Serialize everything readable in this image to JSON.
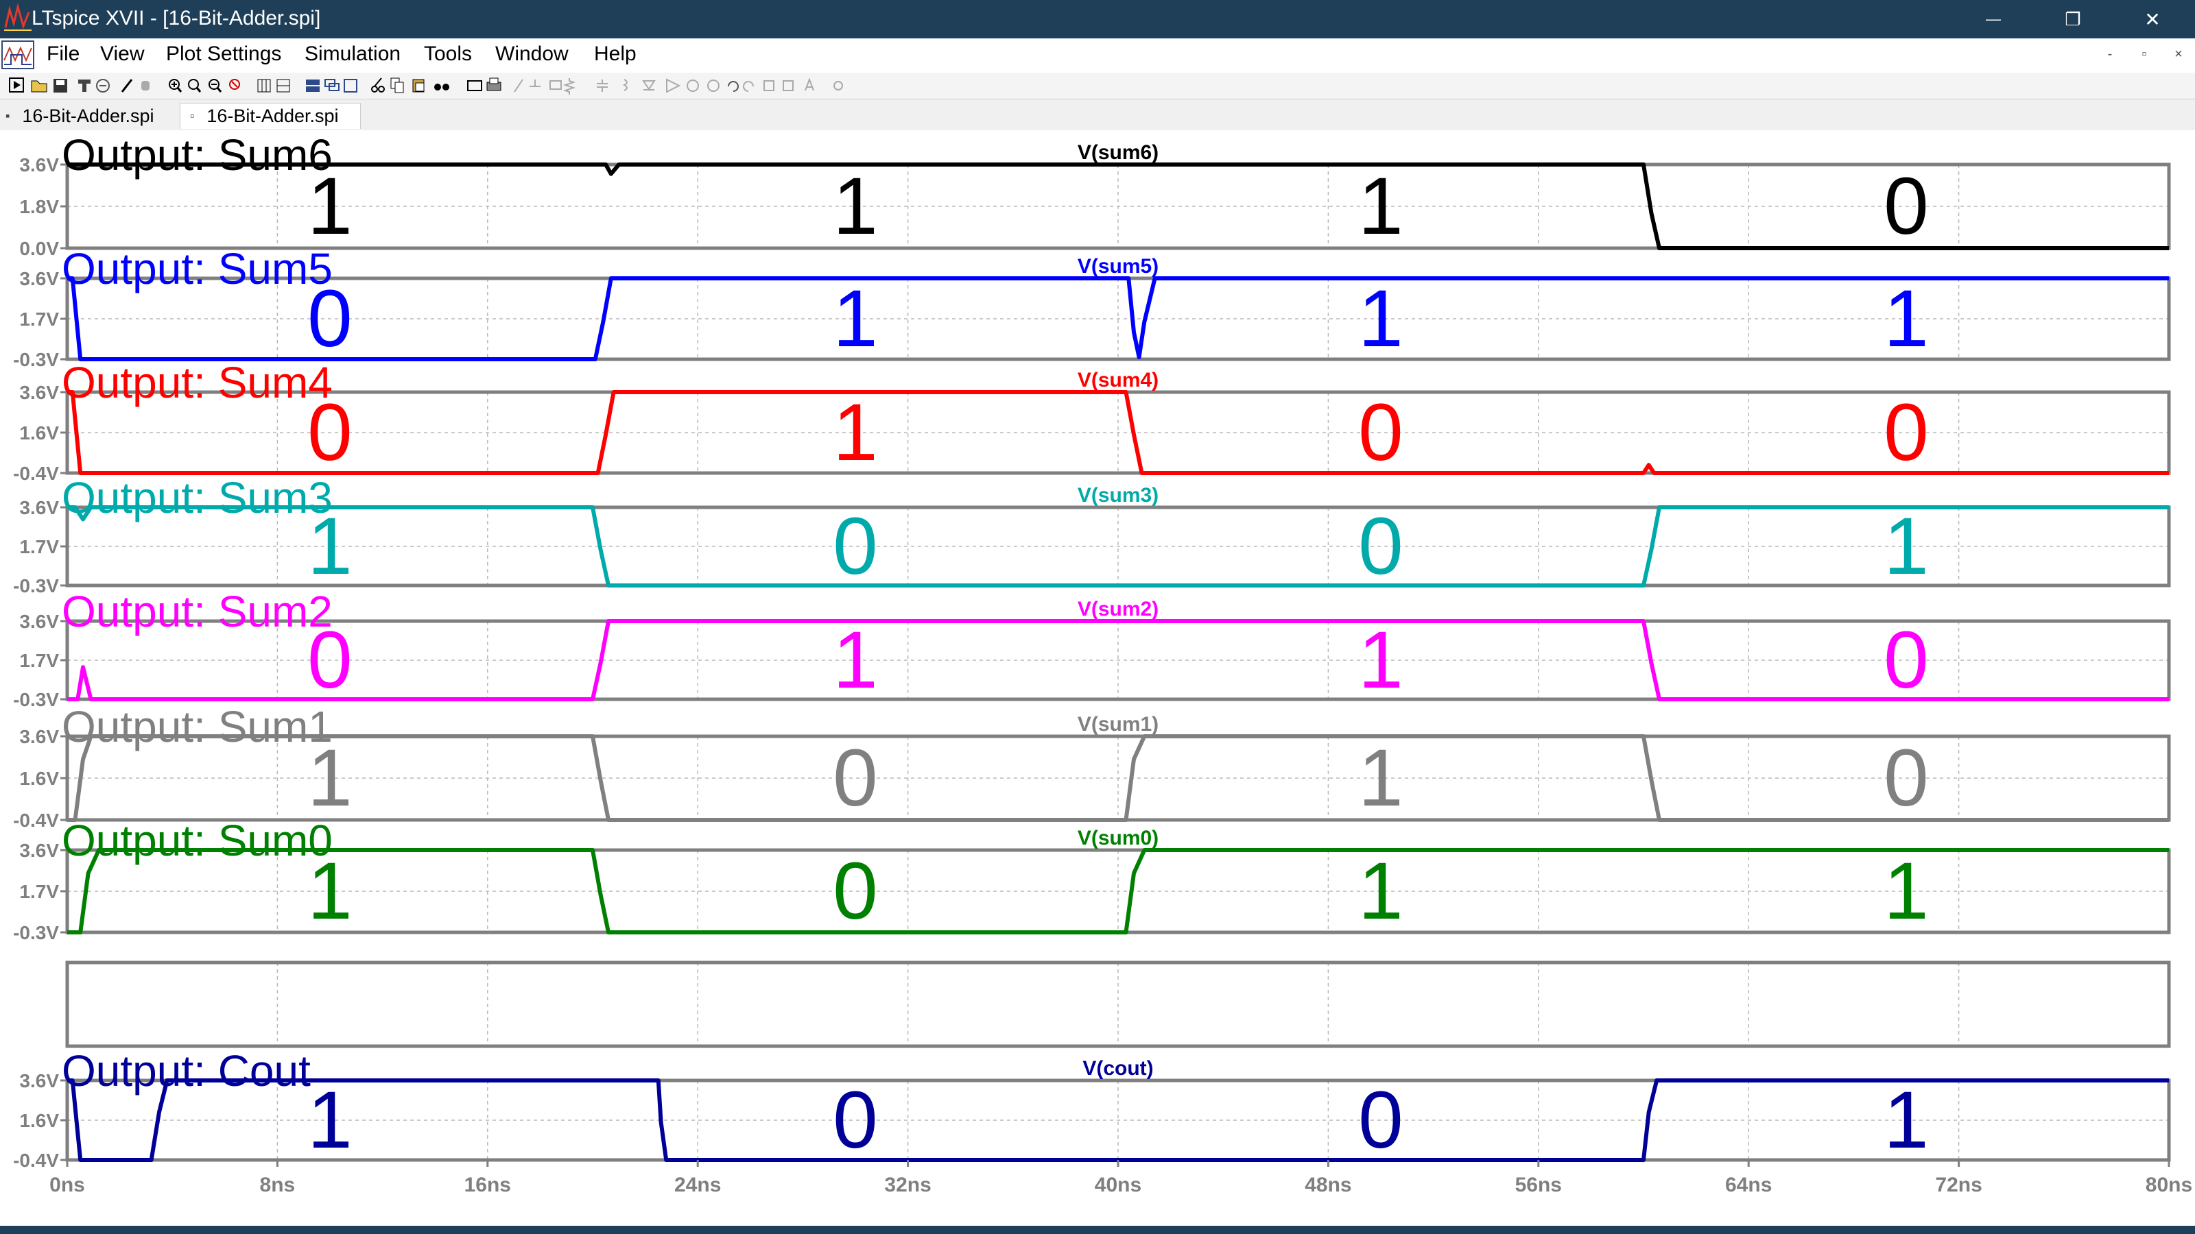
{
  "window": {
    "title": "LTspice XVII - [16-Bit-Adder.spi]",
    "controls": {
      "minimize": "—",
      "restore": "❐",
      "close": "✕"
    }
  },
  "menu": {
    "items": [
      "File",
      "View",
      "Plot Settings",
      "Simulation",
      "Tools",
      "Window",
      "Help"
    ],
    "mdi_controls": [
      "-",
      "▫",
      "×"
    ]
  },
  "tabs": [
    {
      "label": "16-Bit-Adder.spi",
      "icon": "schematic-doc-icon",
      "active": false
    },
    {
      "label": "16-Bit-Adder.spi",
      "icon": "waveform-doc-icon",
      "active": true
    }
  ],
  "colors": {
    "titlebar": "#1f3f58",
    "axis_gray": "#7f7f7f",
    "grid": "#b8b8b8"
  },
  "chart_data": {
    "type": "line",
    "x_unit": "ns",
    "x_ticks": [
      "0ns",
      "8ns",
      "16ns",
      "24ns",
      "32ns",
      "40ns",
      "48ns",
      "56ns",
      "64ns",
      "72ns",
      "80ns"
    ],
    "xlim": [
      0,
      80
    ],
    "panes": [
      {
        "id": "sum6",
        "annotation": "Output: Sum6",
        "trace": "V(sum6)",
        "color": "#000000",
        "ylim": [
          0.0,
          3.6
        ],
        "y_ticks": [
          "3.6V",
          "1.8V",
          "0.0V"
        ],
        "bits": [
          "1",
          "1",
          "1",
          "0"
        ],
        "points": [
          [
            0,
            3.6
          ],
          [
            20.5,
            3.6
          ],
          [
            20.7,
            3.2
          ],
          [
            21,
            3.6
          ],
          [
            60,
            3.6
          ],
          [
            60.3,
            1.5
          ],
          [
            60.6,
            0.0
          ],
          [
            80,
            0.0
          ]
        ]
      },
      {
        "id": "sum5",
        "annotation": "Output: Sum5",
        "trace": "V(sum5)",
        "color": "#0000ff",
        "ylim": [
          -0.3,
          3.6
        ],
        "y_ticks": [
          "3.6V",
          "1.7V",
          "-0.3V"
        ],
        "bits": [
          "0",
          "1",
          "1",
          "1"
        ],
        "points": [
          [
            0,
            3.6
          ],
          [
            0.2,
            3.6
          ],
          [
            0.5,
            -0.3
          ],
          [
            20.1,
            -0.3
          ],
          [
            20.4,
            1.5
          ],
          [
            20.7,
            3.6
          ],
          [
            40.4,
            3.6
          ],
          [
            40.6,
            1.0
          ],
          [
            40.8,
            -0.2
          ],
          [
            41.0,
            1.5
          ],
          [
            41.4,
            3.6
          ],
          [
            80,
            3.6
          ]
        ]
      },
      {
        "id": "sum4",
        "annotation": "Output: Sum4",
        "trace": "V(sum4)",
        "color": "#ff0000",
        "ylim": [
          -0.4,
          3.6
        ],
        "y_ticks": [
          "3.6V",
          "1.6V",
          "-0.4V"
        ],
        "bits": [
          "0",
          "1",
          "0",
          "0"
        ],
        "points": [
          [
            0,
            3.6
          ],
          [
            0.2,
            3.6
          ],
          [
            0.5,
            -0.4
          ],
          [
            20.2,
            -0.4
          ],
          [
            20.5,
            1.5
          ],
          [
            20.8,
            3.6
          ],
          [
            40.3,
            3.6
          ],
          [
            40.6,
            1.5
          ],
          [
            40.9,
            -0.4
          ],
          [
            60,
            -0.4
          ],
          [
            60.2,
            0.0
          ],
          [
            60.4,
            -0.4
          ],
          [
            80,
            -0.4
          ]
        ]
      },
      {
        "id": "sum3",
        "annotation": "Output: Sum3",
        "trace": "V(sum3)",
        "color": "#00aaaa",
        "ylim": [
          -0.3,
          3.6
        ],
        "y_ticks": [
          "3.6V",
          "1.7V",
          "-0.3V"
        ],
        "bits": [
          "1",
          "0",
          "0",
          "1"
        ],
        "points": [
          [
            0,
            3.6
          ],
          [
            0.3,
            3.6
          ],
          [
            0.6,
            3.0
          ],
          [
            0.9,
            3.6
          ],
          [
            20.0,
            3.6
          ],
          [
            20.3,
            1.5
          ],
          [
            20.6,
            -0.3
          ],
          [
            60.0,
            -0.3
          ],
          [
            60.3,
            1.5
          ],
          [
            60.6,
            3.6
          ],
          [
            80,
            3.6
          ]
        ]
      },
      {
        "id": "sum2",
        "annotation": "Output: Sum2",
        "trace": "V(sum2)",
        "color": "#ff00ff",
        "ylim": [
          -0.3,
          3.6
        ],
        "y_ticks": [
          "3.6V",
          "1.7V",
          "-0.3V"
        ],
        "bits": [
          "0",
          "1",
          "1",
          "0"
        ],
        "points": [
          [
            0,
            -0.3
          ],
          [
            0.4,
            -0.3
          ],
          [
            0.6,
            1.3
          ],
          [
            0.9,
            -0.3
          ],
          [
            20.0,
            -0.3
          ],
          [
            20.3,
            1.5
          ],
          [
            20.6,
            3.6
          ],
          [
            60.0,
            3.6
          ],
          [
            60.3,
            1.5
          ],
          [
            60.6,
            -0.3
          ],
          [
            80,
            -0.3
          ]
        ]
      },
      {
        "id": "sum1",
        "annotation": "Output: Sum1",
        "trace": "V(sum1)",
        "color": "#808080",
        "ylim": [
          -0.4,
          3.6
        ],
        "y_ticks": [
          "3.6V",
          "1.6V",
          "-0.4V"
        ],
        "bits": [
          "1",
          "0",
          "1",
          "0"
        ],
        "points": [
          [
            0,
            -0.4
          ],
          [
            0.3,
            -0.4
          ],
          [
            0.6,
            2.5
          ],
          [
            0.9,
            3.6
          ],
          [
            20.0,
            3.6
          ],
          [
            20.3,
            1.5
          ],
          [
            20.6,
            -0.4
          ],
          [
            40.3,
            -0.4
          ],
          [
            40.6,
            2.5
          ],
          [
            41.0,
            3.6
          ],
          [
            60.0,
            3.6
          ],
          [
            60.3,
            1.5
          ],
          [
            60.6,
            -0.4
          ],
          [
            80,
            -0.4
          ]
        ]
      },
      {
        "id": "sum0",
        "annotation": "Output: Sum0",
        "trace": "V(sum0)",
        "color": "#008000",
        "ylim": [
          -0.3,
          3.6
        ],
        "y_ticks": [
          "3.6V",
          "1.7V",
          "-0.3V"
        ],
        "bits": [
          "1",
          "0",
          "1",
          "1"
        ],
        "points": [
          [
            0,
            -0.3
          ],
          [
            0.5,
            -0.3
          ],
          [
            0.8,
            2.5
          ],
          [
            1.2,
            3.6
          ],
          [
            20.0,
            3.6
          ],
          [
            20.3,
            1.5
          ],
          [
            20.6,
            -0.3
          ],
          [
            40.3,
            -0.3
          ],
          [
            40.6,
            2.5
          ],
          [
            41.0,
            3.6
          ],
          [
            80,
            3.6
          ]
        ]
      },
      {
        "id": "blank",
        "annotation": "",
        "trace": "",
        "color": "#000000",
        "ylim": [
          0,
          1
        ],
        "y_ticks": [],
        "bits": [],
        "points": []
      },
      {
        "id": "cout",
        "annotation": "Output: Cout",
        "trace": "V(cout)",
        "color": "#000099",
        "ylim": [
          -0.4,
          3.6
        ],
        "y_ticks": [
          "3.6V",
          "1.6V",
          "-0.4V"
        ],
        "bits": [
          "1",
          "0",
          "0",
          "1"
        ],
        "points": [
          [
            0,
            3.6
          ],
          [
            0.2,
            3.6
          ],
          [
            0.5,
            -0.4
          ],
          [
            3.2,
            -0.4
          ],
          [
            3.5,
            2.0
          ],
          [
            3.8,
            3.6
          ],
          [
            22.5,
            3.6
          ],
          [
            22.6,
            1.5
          ],
          [
            22.8,
            -0.4
          ],
          [
            60.0,
            -0.4
          ],
          [
            60.2,
            2.0
          ],
          [
            60.5,
            3.6
          ],
          [
            80,
            3.6
          ]
        ]
      }
    ]
  }
}
